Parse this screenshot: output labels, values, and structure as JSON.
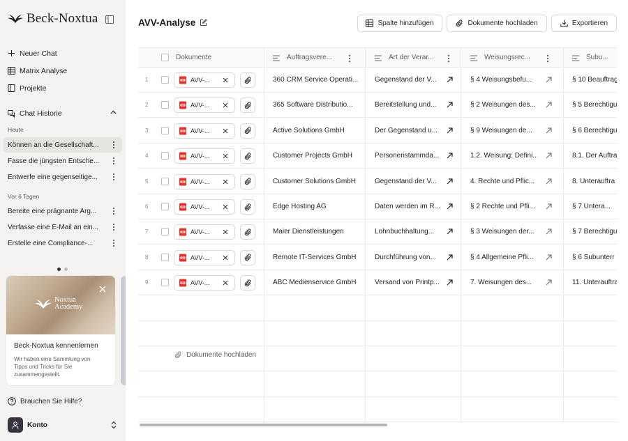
{
  "brand": {
    "name": "Beck-Noxtua"
  },
  "sidebar": {
    "nav": [
      {
        "label": "Neuer Chat",
        "icon": "plus-icon"
      },
      {
        "label": "Matrix Analyse",
        "icon": "grid-icon"
      },
      {
        "label": "Projekte",
        "icon": "book-icon"
      }
    ],
    "history_label": "Chat Historie",
    "groups": [
      {
        "label": "Heute",
        "items": [
          "Können an die Gesellschaft...",
          "Fasse die jüngsten Entsche...",
          "Entwerfe eine gegenseitige..."
        ]
      },
      {
        "label": "Vor 6 Tagen",
        "items": [
          "Bereite eine prägnante Arg...",
          "Verfasse eine E-Mail an ein...",
          "Erstelle eine Compliance-..."
        ]
      }
    ],
    "promo": {
      "logo_line1": "Noxtua",
      "logo_line2": "Academy",
      "title": "Beck-Noxtua kennenlernen",
      "description": "Wir haben eine Sammlung von Tipps und Tricks für Sie zusammengestellt."
    },
    "help_label": "Brauchen Sie Hilfe?",
    "account_label": "Konto"
  },
  "main": {
    "title": "AVV-Analyse",
    "toolbar": {
      "add_column": "Spalte hinzufügen",
      "upload": "Dokumente hochladen",
      "export": "Exportieren"
    },
    "columns": {
      "documents": "Dokumente",
      "c1": "Auftragsvere...",
      "c2": "Art der Verar...",
      "c3": "Weisungsrec...",
      "c4": "Subu..."
    },
    "doc_label": "AVV-...",
    "rows": [
      {
        "num": "1",
        "c1": "360 CRM Service Operati...",
        "c2": "Gegenstand der V...",
        "c3": "§ 4 Weisungsbefu...",
        "c4": "§ 10 Beauftrag"
      },
      {
        "num": "2",
        "c1": "365 Software Distributio...",
        "c2": "Bereitstellung und...",
        "c3": "§ 2 Weisungen des...",
        "c4": "§ 5 Berechtigu"
      },
      {
        "num": "3",
        "c1": "Active Solutions GmbH",
        "c2": "Der Gegenstand u...",
        "c3": "§ 9 Weisungen de...",
        "c4": "§ 6 Berechtigu"
      },
      {
        "num": "4",
        "c1": "Customer Projects GmbH",
        "c2": "Personenstammda...",
        "c3": "1.2. Weisung: Defini...",
        "c4": "8.1. Der Auftra"
      },
      {
        "num": "5",
        "c1": "Customer Solutions GmbH",
        "c2": "Gegenstand der V...",
        "c3": "4. Rechte und Pflic...",
        "c4": "8. Unterauftra"
      },
      {
        "num": "6",
        "c1": "Edge Hosting AG",
        "c2": "Daten werden im R...",
        "c3": "§ 2 Rechte und Pfli...",
        "c4": "§ 7 Untera..."
      },
      {
        "num": "7",
        "c1": "Maier Dienstleistungen",
        "c2": "Lohnbuchhaltung...",
        "c3": "§ 3 Weisungen der...",
        "c4": "§ 7 Berechtigu"
      },
      {
        "num": "8",
        "c1": "Remote IT-Services GmbH",
        "c2": "Durchführung von...",
        "c3": "§ 4 Allgemeine Pfli...",
        "c4": "§ 6 Subunterr"
      },
      {
        "num": "9",
        "c1": "ABC Medienservice GmbH",
        "c2": "Versand von Printp...",
        "c3": "7. Weisungen des...",
        "c4": "11. Unterauftra"
      }
    ],
    "upload_link": "Dokumente hochladen"
  }
}
